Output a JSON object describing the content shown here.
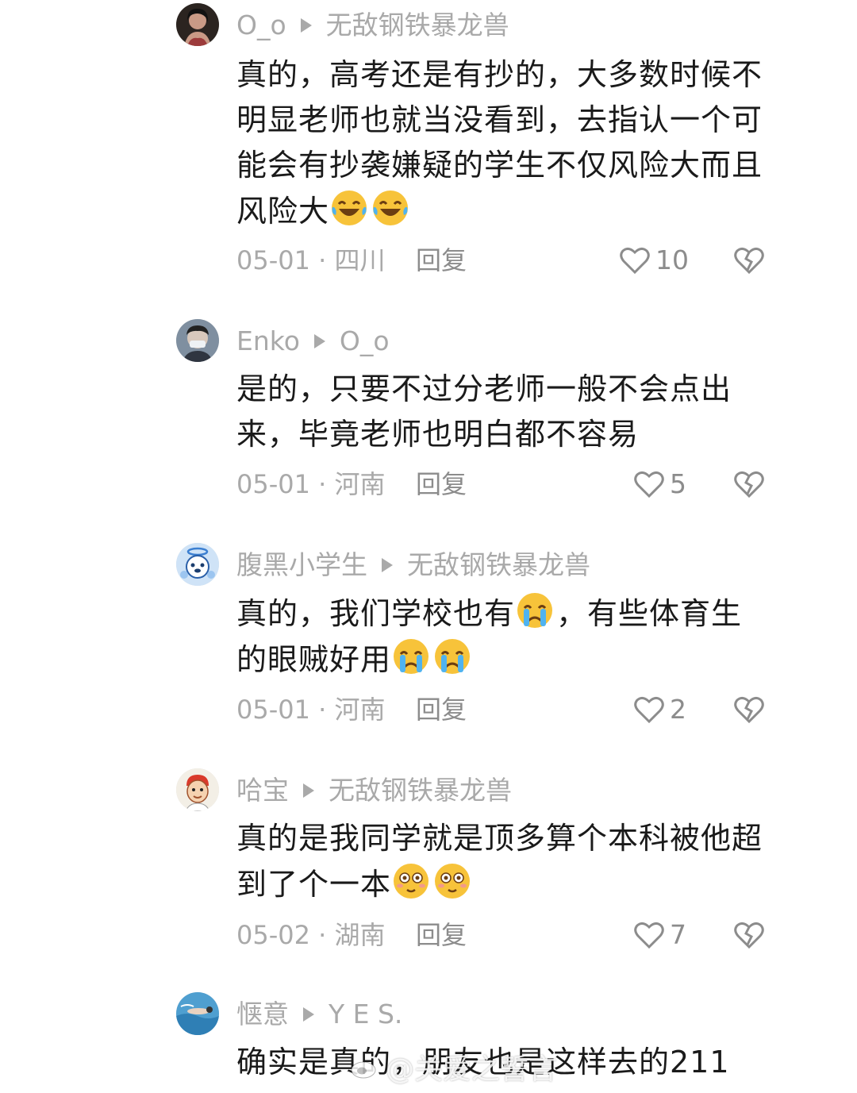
{
  "comments": [
    {
      "user": "O_o",
      "reply_to": "无敌钢铁暴龙兽",
      "lines": [
        "真的，高考还是有抄的，大多数时候不",
        "明显老师也就当没看到，去指认一个可",
        "能会有抄袭嫌疑的学生不仅风险大而且",
        "风险大"
      ],
      "emoji_tail": "laugh-cry-emoji",
      "date": "05-01",
      "location": "四川",
      "reply_label": "回复",
      "likes": "10"
    },
    {
      "user": "Enko",
      "reply_to": "O_o",
      "lines": [
        "是的，只要不过分老师一般不会点出",
        "来，毕竟老师也明白都不容易"
      ],
      "date": "05-01",
      "location": "河南",
      "reply_label": "回复",
      "likes": "5"
    },
    {
      "user": "腹黑小学生",
      "reply_to": "无敌钢铁暴龙兽",
      "line1_a": "真的，我们学校也有",
      "line1_b": "，有些体育生",
      "line2": "的眼贼好用",
      "date": "05-01",
      "location": "河南",
      "reply_label": "回复",
      "likes": "2"
    },
    {
      "user": "哈宝",
      "reply_to": "无敌钢铁暴龙兽",
      "lines": [
        "真的是我同学就是顶多算个本科被他超",
        "到了个一本"
      ],
      "date": "05-02",
      "location": "湖南",
      "reply_label": "回复",
      "likes": "7"
    },
    {
      "user": "惬意",
      "reply_to": "Y E S.",
      "lines": [
        "确实是真的，朋友也是这样去的211"
      ]
    }
  ],
  "watermark": "@关爱之誓言",
  "colors": {
    "text": "#1a1a1a",
    "meta": "#a9a9a9",
    "background": "#ffffff"
  }
}
